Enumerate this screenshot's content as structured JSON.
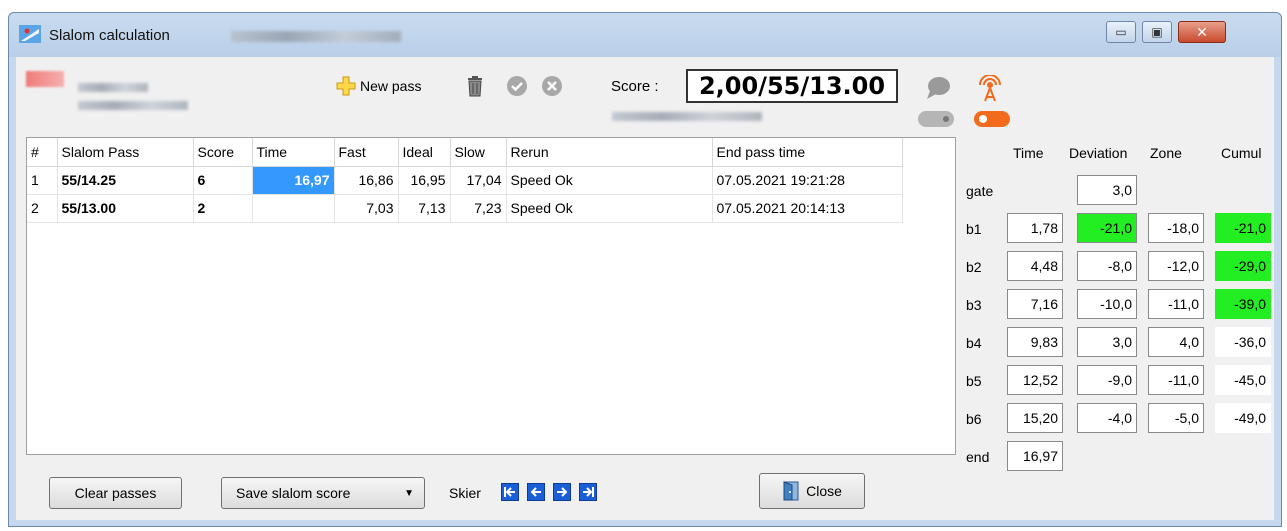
{
  "window": {
    "title": "Slalom calculation",
    "controls": {
      "minimize": "▭",
      "maximize": "▣",
      "close": "✕"
    }
  },
  "toolbar": {
    "new_pass_label": "New pass",
    "score_label": "Score :",
    "score_value": "2,00/55/13.00"
  },
  "passes_table": {
    "columns": [
      "#",
      "Slalom Pass",
      "Score",
      "Time",
      "Fast",
      "Ideal",
      "Slow",
      "Rerun",
      "End pass time"
    ],
    "rows": [
      {
        "num": "1",
        "pass": "55/14.25",
        "score": "6",
        "time": "16,97",
        "fast": "16,86",
        "ideal": "16,95",
        "slow": "17,04",
        "rerun": "Speed Ok",
        "end": "07.05.2021 19:21:28"
      },
      {
        "num": "2",
        "pass": "55/13.00",
        "score": "2",
        "time": "",
        "fast": "7,03",
        "ideal": "7,13",
        "slow": "7,23",
        "rerun": "Speed Ok",
        "end": "07.05.2021 20:14:13"
      }
    ]
  },
  "gate_panel": {
    "headers": {
      "time": "Time",
      "deviation": "Deviation",
      "zone": "Zone",
      "cumul": "Cumul"
    },
    "gate": {
      "label": "gate",
      "deviation": "3,0"
    },
    "buoys": [
      {
        "label": "b1",
        "time": "1,78",
        "deviation": "-21,0",
        "zone": "-18,0",
        "cumul": "-21,0"
      },
      {
        "label": "b2",
        "time": "4,48",
        "deviation": "-8,0",
        "zone": "-12,0",
        "cumul": "-29,0"
      },
      {
        "label": "b3",
        "time": "7,16",
        "deviation": "-10,0",
        "zone": "-11,0",
        "cumul": "-39,0"
      },
      {
        "label": "b4",
        "time": "9,83",
        "deviation": "3,0",
        "zone": "4,0",
        "cumul": "-36,0"
      },
      {
        "label": "b5",
        "time": "12,52",
        "deviation": "-9,0",
        "zone": "-11,0",
        "cumul": "-45,0"
      },
      {
        "label": "b6",
        "time": "15,20",
        "deviation": "-4,0",
        "zone": "-5,0",
        "cumul": "-49,0"
      }
    ],
    "end": {
      "label": "end",
      "time": "16,97"
    },
    "highlight_color": "#22ee22"
  },
  "footer": {
    "clear_label": "Clear passes",
    "save_label": "Save slalom score",
    "skier_label": "Skier",
    "close_label": "Close"
  },
  "icons": {
    "app": "ski-icon",
    "new_pass": "plus-icon",
    "trash": "trash-icon",
    "check": "check-circle-icon",
    "cancel": "x-circle-icon",
    "nav": [
      "first-icon",
      "prev-icon",
      "next-icon",
      "last-icon"
    ],
    "close": "door-icon"
  },
  "colors": {
    "selection": "#3399ff",
    "accent_orange": "#f26b1d"
  }
}
